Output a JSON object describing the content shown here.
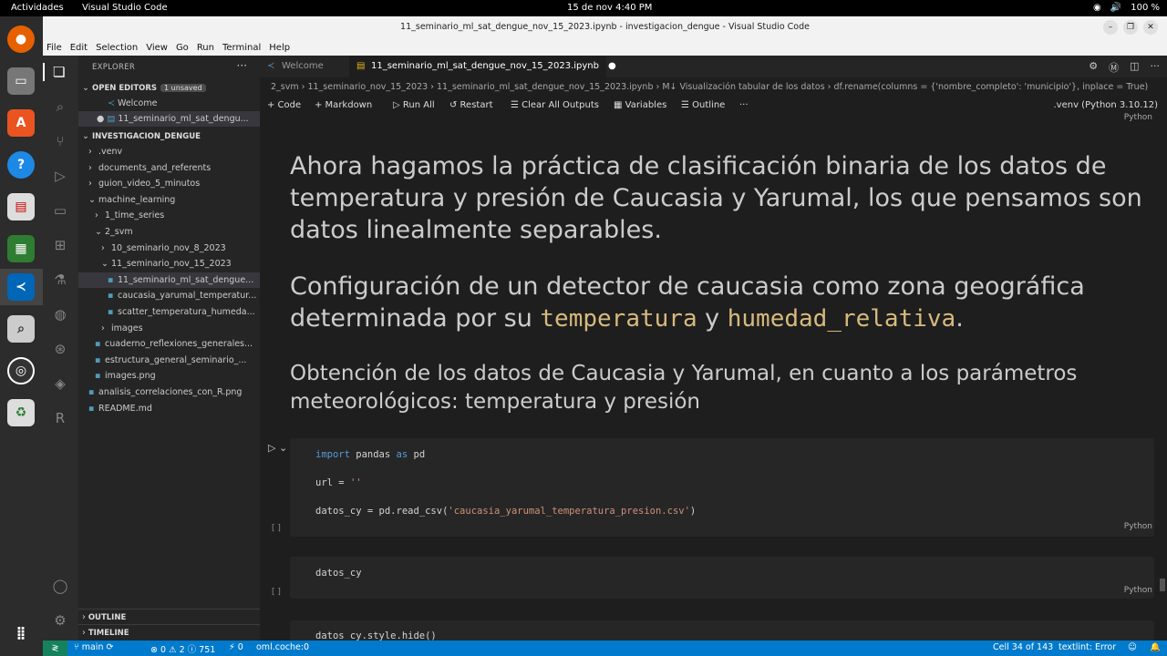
{
  "topbar": {
    "activities": "Actividades",
    "app": "Visual Studio Code",
    "clock": "15 de nov  4:40 PM",
    "battery": "100 %"
  },
  "window": {
    "title": "11_seminario_ml_sat_dengue_nov_15_2023.ipynb - investigacion_dengue - Visual Studio Code"
  },
  "menu": [
    "File",
    "Edit",
    "Selection",
    "View",
    "Go",
    "Run",
    "Terminal",
    "Help"
  ],
  "explorer": {
    "title": "EXPLORER",
    "open_editors": "OPEN EDITORS",
    "unsaved": "1 unsaved",
    "open_items": [
      "Welcome",
      "11_seminario_ml_sat_dengu..."
    ],
    "workspace": "INVESTIGACION_DENGUE",
    "tree": [
      {
        "label": ".venv",
        "depth": 1,
        "chev": "›"
      },
      {
        "label": "documents_and_referents",
        "depth": 1,
        "chev": "›"
      },
      {
        "label": "guion_video_5_minutos",
        "depth": 1,
        "chev": "›"
      },
      {
        "label": "machine_learning",
        "depth": 1,
        "chev": "⌄"
      },
      {
        "label": "1_time_series",
        "depth": 2,
        "chev": "›"
      },
      {
        "label": "2_svm",
        "depth": 2,
        "chev": "⌄"
      },
      {
        "label": "10_seminario_nov_8_2023",
        "depth": 3,
        "chev": "›"
      },
      {
        "label": "11_seminario_nov_15_2023",
        "depth": 3,
        "chev": "⌄"
      },
      {
        "label": "11_seminario_ml_sat_dengue...",
        "depth": 4,
        "chev": ""
      },
      {
        "label": "caucasia_yarumal_temperatur...",
        "depth": 4,
        "chev": ""
      },
      {
        "label": "scatter_temperatura_humeda...",
        "depth": 4,
        "chev": ""
      },
      {
        "label": "images",
        "depth": 3,
        "chev": "›"
      },
      {
        "label": "cuaderno_reflexiones_generales...",
        "depth": 2,
        "chev": ""
      },
      {
        "label": "estructura_general_seminario_...",
        "depth": 2,
        "chev": ""
      },
      {
        "label": "images.png",
        "depth": 2,
        "chev": ""
      },
      {
        "label": "analisis_correlaciones_con_R.png",
        "depth": 1,
        "chev": ""
      },
      {
        "label": "README.md",
        "depth": 1,
        "chev": ""
      }
    ],
    "outline": "OUTLINE",
    "timeline": "TIMELINE"
  },
  "tabs": [
    {
      "label": "Welcome"
    },
    {
      "label": "11_seminario_ml_sat_dengue_nov_15_2023.ipynb"
    }
  ],
  "breadcrumb": "2_svm  ›  11_seminario_nov_15_2023  ›  11_seminario_ml_sat_dengue_nov_15_2023.ipynb  ›  M↓ Visualización tabular de los datos  ›  df.rename(columns = {'nombre_completo': 'municipio'}, inplace = True)",
  "toolbar": {
    "code": "+ Code",
    "markdown": "+ Markdown",
    "run_all": "▷ Run All",
    "restart": "↺ Restart",
    "clear": "☰ Clear All Outputs",
    "variables": "▦ Variables",
    "outline": "☰ Outline",
    "more": "···",
    "kernel": ".venv (Python 3.10.12)"
  },
  "markdown": {
    "p1": "Ahora hagamos la práctica de clasificación binaria de los datos de temperatura y presión de Caucasia y Yarumal, los que pensamos son datos linealmente separables.",
    "p2_a": "Configuración de un detector de caucasia como zona geográfica determinada por su ",
    "p2_code1": "temperatura",
    "p2_mid": " y ",
    "p2_code2": "humedad_relativa",
    "p2_end": ".",
    "p3": "Obtención de los datos de Caucasia y Yarumal, en cuanto a los parámetros meteorológicos: temperatura y presión"
  },
  "cells": {
    "lang": "Python",
    "exec": "[ ]",
    "c1_l1_kw": "import",
    "c1_l1_a": " pandas ",
    "c1_l1_kw2": "as",
    "c1_l1_b": " pd",
    "c1_l2_a": "url = ",
    "c1_l2_str": "''",
    "c1_l3_a": "datos_cy = pd.read_csv(",
    "c1_l3_str": "'caucasia_yarumal_temperatura_presion.csv'",
    "c1_l3_b": ")",
    "c2": "datos_cy",
    "c3": "datos_cy.style.hide()"
  },
  "status": {
    "branch": "main",
    "errors": "⊗ 0 ⚠ 2 ⓘ 751",
    "ports": "⚡ 0",
    "lang": "oml.coche:0",
    "cell": "Cell 34 of 143",
    "lint": "textlint: Error"
  }
}
